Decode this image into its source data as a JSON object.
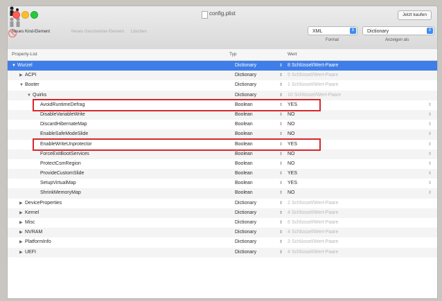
{
  "window": {
    "title": "config.plist",
    "buy_button": "Jetzt kaufen"
  },
  "toolbar": {
    "new_child_label": "Neues Kind-Element",
    "new_sibling_label": "Neues Geschwister-Element",
    "delete_label": "Löschen",
    "format_value": "XML",
    "format_caption": "Format",
    "show_value": "Dictionary",
    "show_caption": "Anzeigen als"
  },
  "columns": {
    "key": "Property-List",
    "type": "Typ",
    "value": "Wert"
  },
  "rows": [
    {
      "key": "Wurzel",
      "type": "Dictionary",
      "value": "8 Schlüssel/Wert-Paare",
      "level": 0,
      "expanded": true,
      "selected": true
    },
    {
      "key": "ACPI",
      "type": "Dictionary",
      "value": "5 Schlüssel/Wert-Paare",
      "level": 1,
      "expanded": false
    },
    {
      "key": "Booter",
      "type": "Dictionary",
      "value": "1 Schlüssel/Wert-Paare",
      "level": 1,
      "expanded": true
    },
    {
      "key": "Quirks",
      "type": "Dictionary",
      "value": "10 Schlüssel/Wert-Paare",
      "level": 2,
      "expanded": true
    },
    {
      "key": "AvoidRuntimeDefrag",
      "type": "Boolean",
      "value": "YES",
      "level": 3,
      "highlight": true
    },
    {
      "key": "DisableVariableWrite",
      "type": "Boolean",
      "value": "NO",
      "level": 3
    },
    {
      "key": "DiscardHibernateMap",
      "type": "Boolean",
      "value": "NO",
      "level": 3
    },
    {
      "key": "EnableSafeModeSlide",
      "type": "Boolean",
      "value": "NO",
      "level": 3
    },
    {
      "key": "EnableWriteUnprotector",
      "type": "Boolean",
      "value": "YES",
      "level": 3,
      "highlight": true
    },
    {
      "key": "ForceExitBootServices",
      "type": "Boolean",
      "value": "NO",
      "level": 3
    },
    {
      "key": "ProtectCsmRegion",
      "type": "Boolean",
      "value": "NO",
      "level": 3
    },
    {
      "key": "ProvideCustomSlide",
      "type": "Boolean",
      "value": "YES",
      "level": 3
    },
    {
      "key": "SetupVirtualMap",
      "type": "Boolean",
      "value": "YES",
      "level": 3
    },
    {
      "key": "ShrinkMemoryMap",
      "type": "Boolean",
      "value": "NO",
      "level": 3
    },
    {
      "key": "DeviceProperties",
      "type": "Dictionary",
      "value": "2 Schlüssel/Wert-Paare",
      "level": 1,
      "expanded": false
    },
    {
      "key": "Kernel",
      "type": "Dictionary",
      "value": "4 Schlüssel/Wert-Paare",
      "level": 1,
      "expanded": false
    },
    {
      "key": "Misc",
      "type": "Dictionary",
      "value": "6 Schlüssel/Wert-Paare",
      "level": 1,
      "expanded": false
    },
    {
      "key": "NVRAM",
      "type": "Dictionary",
      "value": "4 Schlüssel/Wert-Paare",
      "level": 1,
      "expanded": false
    },
    {
      "key": "PlatformInfo",
      "type": "Dictionary",
      "value": "3 Schlüssel/Wert-Paare",
      "level": 1,
      "expanded": false
    },
    {
      "key": "UEFI",
      "type": "Dictionary",
      "value": "4 Schlüssel/Wert-Paare",
      "level": 1,
      "expanded": false
    }
  ],
  "colors": {
    "selection": "#3f7ee8",
    "highlight_box": "#d8262a",
    "accent": "#3c8cf2"
  }
}
